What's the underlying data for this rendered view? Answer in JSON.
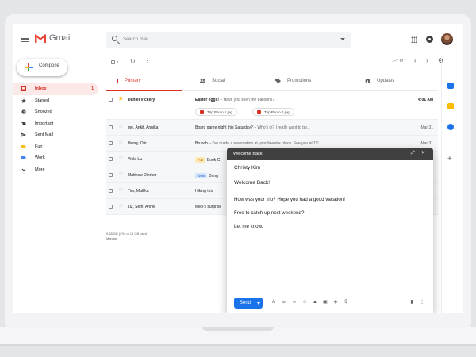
{
  "app": {
    "name": "Gmail"
  },
  "search": {
    "placeholder": "Search mail"
  },
  "sidebar": {
    "compose_label": "Compose",
    "items": [
      {
        "label": "Inbox",
        "count": "1"
      },
      {
        "label": "Starred"
      },
      {
        "label": "Snoozed"
      },
      {
        "label": "Important"
      },
      {
        "label": "Sent Mail"
      },
      {
        "label": "Fun"
      },
      {
        "label": "Work"
      },
      {
        "label": "More"
      }
    ]
  },
  "toolbar": {
    "pager": "1–7 of 7"
  },
  "tabs": [
    {
      "label": "Primary"
    },
    {
      "label": "Social"
    },
    {
      "label": "Promotions"
    },
    {
      "label": "Updates"
    }
  ],
  "emails": [
    {
      "sender": "Daniel Vickery",
      "subject": "Easter eggs!",
      "snippet": " – Have you seen the balloons?",
      "date": "4:01 AM",
      "attachments": [
        "Trip Photo 1.jpg",
        "Trip Photo 2.jpg"
      ]
    },
    {
      "sender": "me, Ankit, Annika",
      "subject": "Board game night this Saturday?",
      "snippet": " – Who's in? I really want to try...",
      "date": "Mar 31"
    },
    {
      "sender": "Henry, Ofir",
      "subject": "Brunch",
      "snippet": " – I've made a reservation at your favorite place. See you at 11!",
      "date": "Mar 31"
    },
    {
      "sender": "Viola Lu",
      "label": "Fun",
      "subject": "Book C",
      "snippet": "",
      "date": ""
    },
    {
      "sender": "Matthew Dierker",
      "label": "Work",
      "subject": "Bring",
      "snippet": "",
      "date": ""
    },
    {
      "sender": "Tim, Mallika",
      "subject": "Hiking this",
      "snippet": "",
      "date": ""
    },
    {
      "sender": "Liz, Seth, Annie",
      "subject": "Mike's surprise",
      "snippet": "",
      "date": ""
    }
  ],
  "storage": {
    "line1": "0.28 GB (2%) of 15 GB used",
    "line2": "Manage"
  },
  "compose_window": {
    "title": "Welcome Back!",
    "to": "Christy Kim",
    "subject": "Welcome Back!",
    "body": [
      "How was your trip? Hope you had a good vacation!",
      "Free to catch-up next weekend?",
      "Let me know."
    ],
    "send_label": "Send",
    "minimize": "_",
    "expand": "⤢",
    "close": "✕"
  },
  "colors": {
    "accent_red": "#d93025",
    "send_blue": "#1a73e8",
    "star_yellow": "#f4b400",
    "compose_header": "#404040"
  }
}
